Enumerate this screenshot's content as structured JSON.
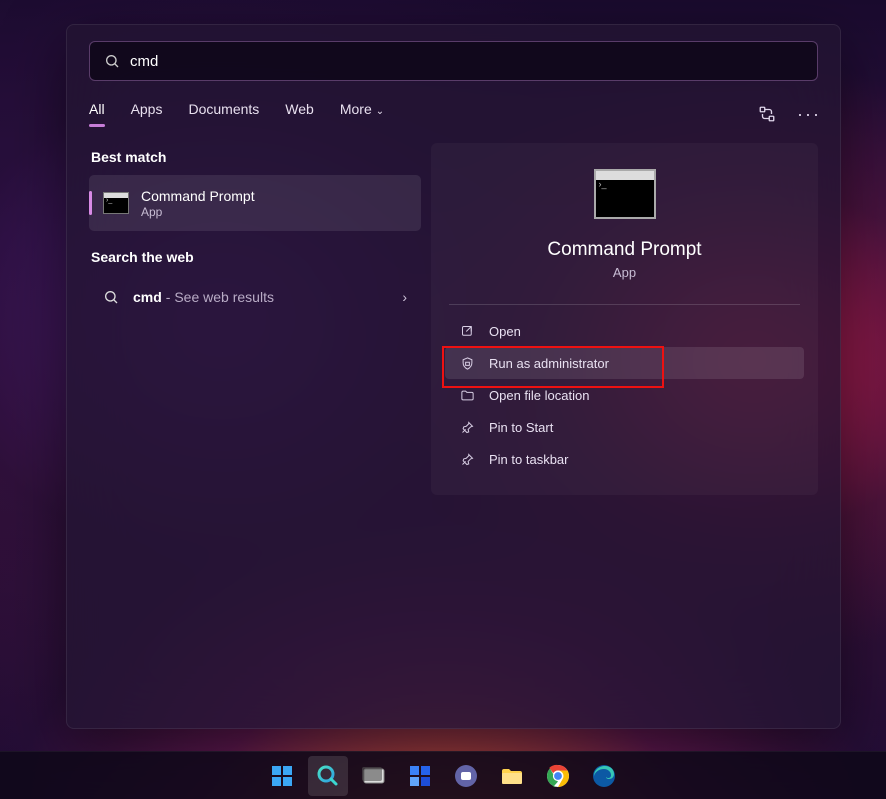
{
  "search": {
    "query": "cmd"
  },
  "tabs": {
    "items": [
      "All",
      "Apps",
      "Documents",
      "Web",
      "More"
    ],
    "active": 0
  },
  "best_match": {
    "heading": "Best match",
    "title": "Command Prompt",
    "subtitle": "App"
  },
  "web_search": {
    "heading": "Search the web",
    "term": "cmd",
    "suffix": "- See web results"
  },
  "preview": {
    "title": "Command Prompt",
    "subtitle": "App",
    "actions": [
      {
        "id": "open",
        "label": "Open",
        "icon": "open-icon"
      },
      {
        "id": "run-admin",
        "label": "Run as administrator",
        "icon": "shield-icon"
      },
      {
        "id": "open-loc",
        "label": "Open file location",
        "icon": "folder-icon"
      },
      {
        "id": "pin-start",
        "label": "Pin to Start",
        "icon": "pin-icon"
      },
      {
        "id": "pin-taskbar",
        "label": "Pin to taskbar",
        "icon": "pin-icon"
      }
    ],
    "hover_index": 1,
    "highlight_index": 1
  },
  "taskbar": {
    "items": [
      {
        "id": "start",
        "icon": "windows-icon"
      },
      {
        "id": "search",
        "icon": "search-icon",
        "active": true
      },
      {
        "id": "taskview",
        "icon": "taskview-icon"
      },
      {
        "id": "widgets",
        "icon": "widgets-icon"
      },
      {
        "id": "chat",
        "icon": "chat-icon"
      },
      {
        "id": "explorer",
        "icon": "explorer-icon"
      },
      {
        "id": "chrome",
        "icon": "chrome-icon"
      },
      {
        "id": "edge",
        "icon": "edge-icon"
      }
    ]
  }
}
